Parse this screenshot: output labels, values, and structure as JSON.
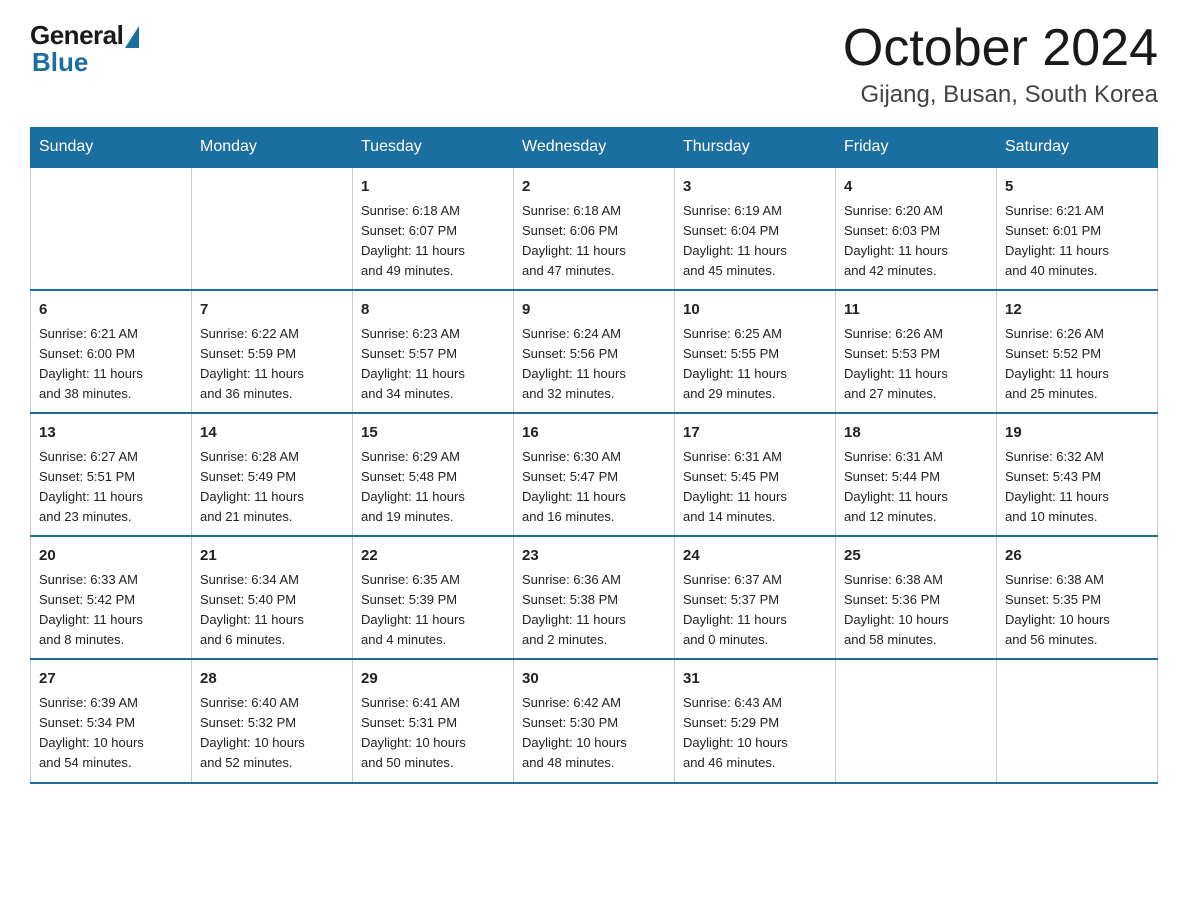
{
  "header": {
    "logo_general": "General",
    "logo_blue": "Blue",
    "month_title": "October 2024",
    "location": "Gijang, Busan, South Korea"
  },
  "weekdays": [
    "Sunday",
    "Monday",
    "Tuesday",
    "Wednesday",
    "Thursday",
    "Friday",
    "Saturday"
  ],
  "weeks": [
    [
      {
        "day": "",
        "info": ""
      },
      {
        "day": "",
        "info": ""
      },
      {
        "day": "1",
        "info": "Sunrise: 6:18 AM\nSunset: 6:07 PM\nDaylight: 11 hours\nand 49 minutes."
      },
      {
        "day": "2",
        "info": "Sunrise: 6:18 AM\nSunset: 6:06 PM\nDaylight: 11 hours\nand 47 minutes."
      },
      {
        "day": "3",
        "info": "Sunrise: 6:19 AM\nSunset: 6:04 PM\nDaylight: 11 hours\nand 45 minutes."
      },
      {
        "day": "4",
        "info": "Sunrise: 6:20 AM\nSunset: 6:03 PM\nDaylight: 11 hours\nand 42 minutes."
      },
      {
        "day": "5",
        "info": "Sunrise: 6:21 AM\nSunset: 6:01 PM\nDaylight: 11 hours\nand 40 minutes."
      }
    ],
    [
      {
        "day": "6",
        "info": "Sunrise: 6:21 AM\nSunset: 6:00 PM\nDaylight: 11 hours\nand 38 minutes."
      },
      {
        "day": "7",
        "info": "Sunrise: 6:22 AM\nSunset: 5:59 PM\nDaylight: 11 hours\nand 36 minutes."
      },
      {
        "day": "8",
        "info": "Sunrise: 6:23 AM\nSunset: 5:57 PM\nDaylight: 11 hours\nand 34 minutes."
      },
      {
        "day": "9",
        "info": "Sunrise: 6:24 AM\nSunset: 5:56 PM\nDaylight: 11 hours\nand 32 minutes."
      },
      {
        "day": "10",
        "info": "Sunrise: 6:25 AM\nSunset: 5:55 PM\nDaylight: 11 hours\nand 29 minutes."
      },
      {
        "day": "11",
        "info": "Sunrise: 6:26 AM\nSunset: 5:53 PM\nDaylight: 11 hours\nand 27 minutes."
      },
      {
        "day": "12",
        "info": "Sunrise: 6:26 AM\nSunset: 5:52 PM\nDaylight: 11 hours\nand 25 minutes."
      }
    ],
    [
      {
        "day": "13",
        "info": "Sunrise: 6:27 AM\nSunset: 5:51 PM\nDaylight: 11 hours\nand 23 minutes."
      },
      {
        "day": "14",
        "info": "Sunrise: 6:28 AM\nSunset: 5:49 PM\nDaylight: 11 hours\nand 21 minutes."
      },
      {
        "day": "15",
        "info": "Sunrise: 6:29 AM\nSunset: 5:48 PM\nDaylight: 11 hours\nand 19 minutes."
      },
      {
        "day": "16",
        "info": "Sunrise: 6:30 AM\nSunset: 5:47 PM\nDaylight: 11 hours\nand 16 minutes."
      },
      {
        "day": "17",
        "info": "Sunrise: 6:31 AM\nSunset: 5:45 PM\nDaylight: 11 hours\nand 14 minutes."
      },
      {
        "day": "18",
        "info": "Sunrise: 6:31 AM\nSunset: 5:44 PM\nDaylight: 11 hours\nand 12 minutes."
      },
      {
        "day": "19",
        "info": "Sunrise: 6:32 AM\nSunset: 5:43 PM\nDaylight: 11 hours\nand 10 minutes."
      }
    ],
    [
      {
        "day": "20",
        "info": "Sunrise: 6:33 AM\nSunset: 5:42 PM\nDaylight: 11 hours\nand 8 minutes."
      },
      {
        "day": "21",
        "info": "Sunrise: 6:34 AM\nSunset: 5:40 PM\nDaylight: 11 hours\nand 6 minutes."
      },
      {
        "day": "22",
        "info": "Sunrise: 6:35 AM\nSunset: 5:39 PM\nDaylight: 11 hours\nand 4 minutes."
      },
      {
        "day": "23",
        "info": "Sunrise: 6:36 AM\nSunset: 5:38 PM\nDaylight: 11 hours\nand 2 minutes."
      },
      {
        "day": "24",
        "info": "Sunrise: 6:37 AM\nSunset: 5:37 PM\nDaylight: 11 hours\nand 0 minutes."
      },
      {
        "day": "25",
        "info": "Sunrise: 6:38 AM\nSunset: 5:36 PM\nDaylight: 10 hours\nand 58 minutes."
      },
      {
        "day": "26",
        "info": "Sunrise: 6:38 AM\nSunset: 5:35 PM\nDaylight: 10 hours\nand 56 minutes."
      }
    ],
    [
      {
        "day": "27",
        "info": "Sunrise: 6:39 AM\nSunset: 5:34 PM\nDaylight: 10 hours\nand 54 minutes."
      },
      {
        "day": "28",
        "info": "Sunrise: 6:40 AM\nSunset: 5:32 PM\nDaylight: 10 hours\nand 52 minutes."
      },
      {
        "day": "29",
        "info": "Sunrise: 6:41 AM\nSunset: 5:31 PM\nDaylight: 10 hours\nand 50 minutes."
      },
      {
        "day": "30",
        "info": "Sunrise: 6:42 AM\nSunset: 5:30 PM\nDaylight: 10 hours\nand 48 minutes."
      },
      {
        "day": "31",
        "info": "Sunrise: 6:43 AM\nSunset: 5:29 PM\nDaylight: 10 hours\nand 46 minutes."
      },
      {
        "day": "",
        "info": ""
      },
      {
        "day": "",
        "info": ""
      }
    ]
  ]
}
